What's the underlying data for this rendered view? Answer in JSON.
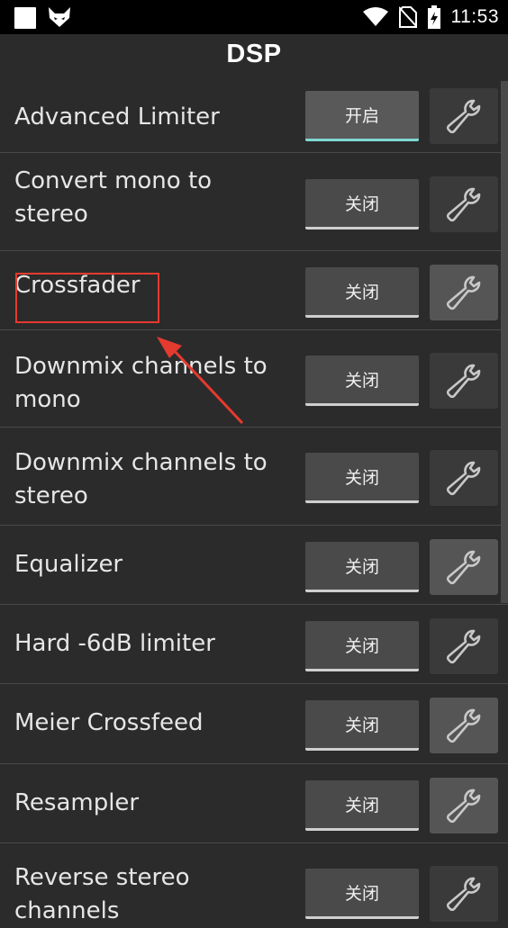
{
  "status_bar": {
    "time": "11:53",
    "icons": [
      "square-notification-icon",
      "fox-app-icon",
      "wifi-icon",
      "no-sim-icon",
      "battery-charging-icon"
    ]
  },
  "app_bar": {
    "title": "DSP"
  },
  "colors": {
    "background": "#2b2b2b",
    "divider": "#4a4a4a",
    "toggle_on_underline": "#7fd9d3",
    "toggle_off_underline": "#cfcfcf",
    "annotation_red": "#e53a2f"
  },
  "dsp_items": [
    {
      "label": "Advanced Limiter",
      "toggle": "开启",
      "state": "on"
    },
    {
      "label": "Convert mono to stereo",
      "toggle": "关闭",
      "state": "off"
    },
    {
      "label": "Crossfader",
      "toggle": "关闭",
      "state": "off"
    },
    {
      "label": "Downmix channels to mono",
      "toggle": "关闭",
      "state": "off"
    },
    {
      "label": "Downmix channels to stereo",
      "toggle": "关闭",
      "state": "off"
    },
    {
      "label": "Equalizer",
      "toggle": "关闭",
      "state": "off"
    },
    {
      "label": "Hard -6dB limiter",
      "toggle": "关闭",
      "state": "off"
    },
    {
      "label": "Meier Crossfeed",
      "toggle": "关闭",
      "state": "off"
    },
    {
      "label": "Resampler",
      "toggle": "关闭",
      "state": "off"
    },
    {
      "label": "Reverse stereo channels",
      "toggle": "关闭",
      "state": "off"
    }
  ]
}
